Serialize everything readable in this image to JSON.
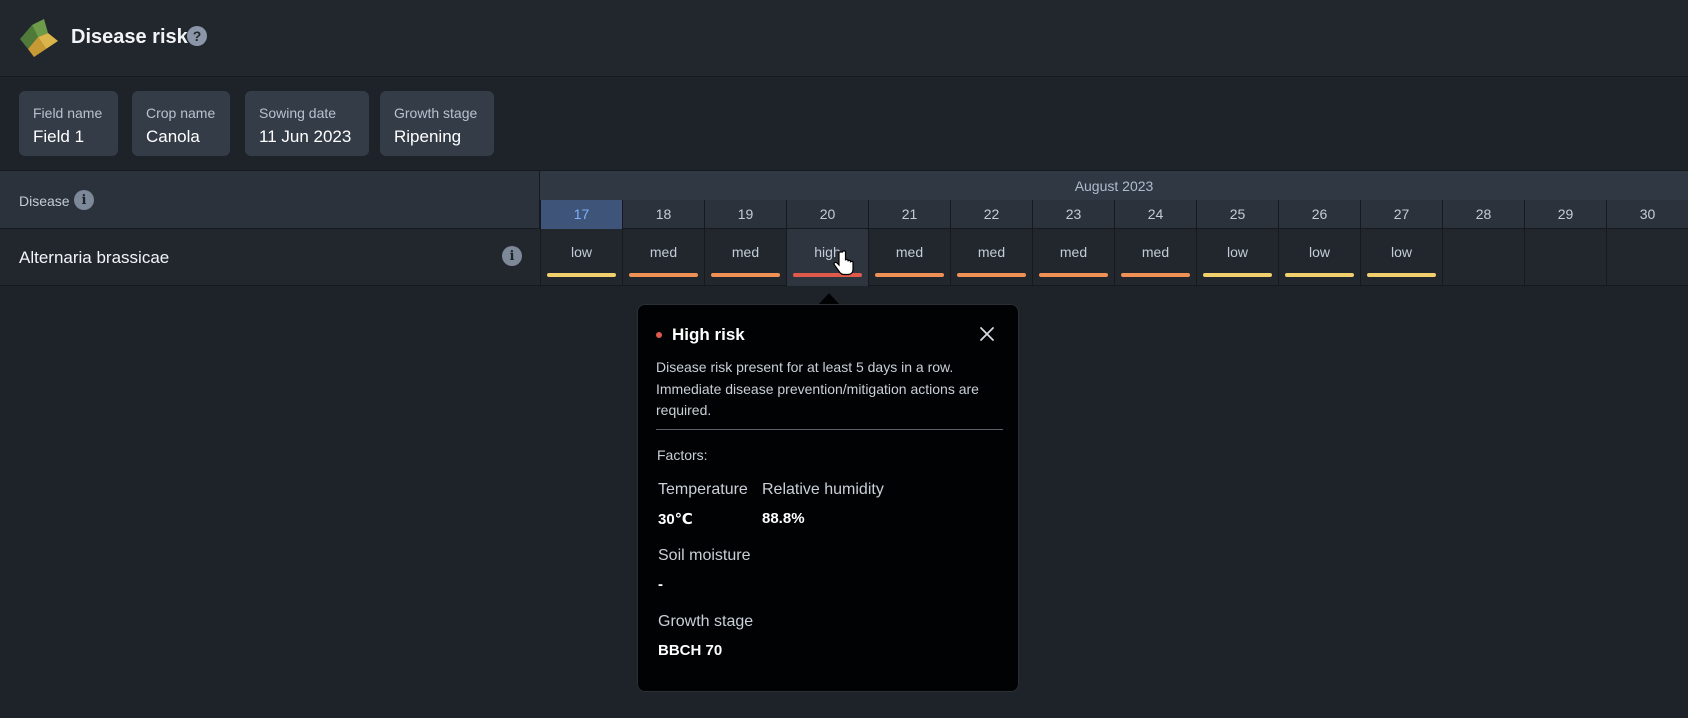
{
  "header": {
    "title": "Disease risk",
    "help_icon": "question-mark-icon",
    "help_glyph": "?"
  },
  "cards": [
    {
      "label": "Field name",
      "value": "Field 1"
    },
    {
      "label": "Crop name",
      "value": "Canola"
    },
    {
      "label": "Sowing date",
      "value": "11 Jun 2023"
    },
    {
      "label": "Growth stage",
      "value": "Ripening"
    }
  ],
  "table": {
    "disease_header": "Disease",
    "info_glyph": "i",
    "month": "August 2023",
    "today": "17",
    "days": [
      "17",
      "18",
      "19",
      "20",
      "21",
      "22",
      "23",
      "24",
      "25",
      "26",
      "27",
      "28",
      "29",
      "30"
    ],
    "row": {
      "disease": "Alternaria brassicae",
      "risks": [
        "low",
        "med",
        "med",
        "high",
        "med",
        "med",
        "med",
        "med",
        "low",
        "low",
        "low",
        "",
        "",
        ""
      ]
    }
  },
  "risk_colors": {
    "low": "#f2cf6d",
    "med": "#ef9055",
    "high": "#e05a4b"
  },
  "popover": {
    "title": "High risk",
    "description": "Disease risk present for at least 5 days in a row. Immediate disease prevention/mitigation actions are required.",
    "factors_label": "Factors:",
    "factors": [
      {
        "label": "Temperature",
        "value": "30℃"
      },
      {
        "label": "Relative humidity",
        "value": "88.8%"
      },
      {
        "label": "Soil moisture",
        "value": "-"
      },
      {
        "label": "Growth stage",
        "value": "BBCH 70"
      }
    ]
  }
}
